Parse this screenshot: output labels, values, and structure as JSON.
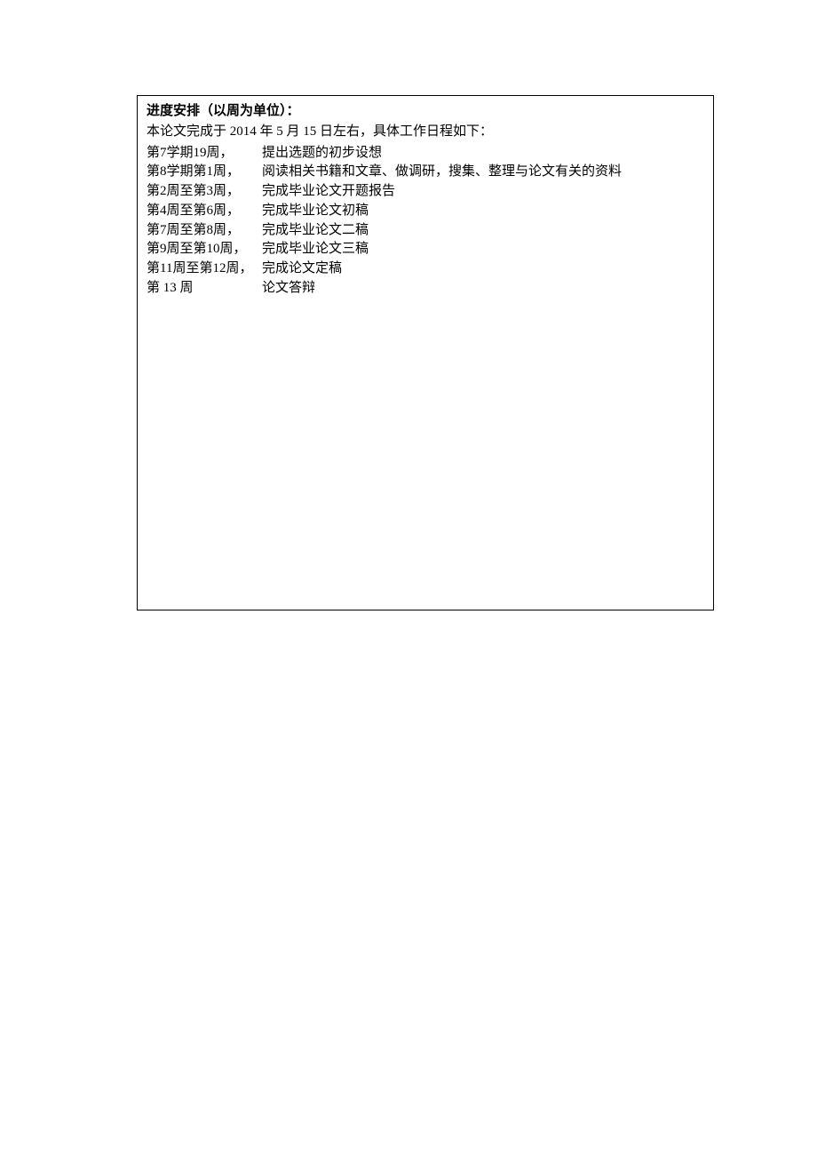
{
  "heading": "进度安排（以周为单位）：",
  "intro": "本论文完成于 2014 年 5 月 15 日左右，具体工作日程如下：",
  "schedule": [
    {
      "period": "第7学期19周，",
      "desc": "提出选题的初步设想"
    },
    {
      "period": "第8学期第1周，",
      "desc": "阅读相关书籍和文章、做调研，搜集、整理与论文有关的资料"
    },
    {
      "period": "第2周至第3周，",
      "desc": "完成毕业论文开题报告"
    },
    {
      "period": "第4周至第6周，",
      "desc": "完成毕业论文初稿"
    },
    {
      "period": "第7周至第8周，",
      "desc": "完成毕业论文二稿"
    },
    {
      "period": "第9周至第10周，",
      "desc": "完成毕业论文三稿"
    },
    {
      "period": "第11周至第12周，",
      "desc": "完成论文定稿"
    },
    {
      "period": "第 13 周",
      "desc": "论文答辩"
    }
  ]
}
